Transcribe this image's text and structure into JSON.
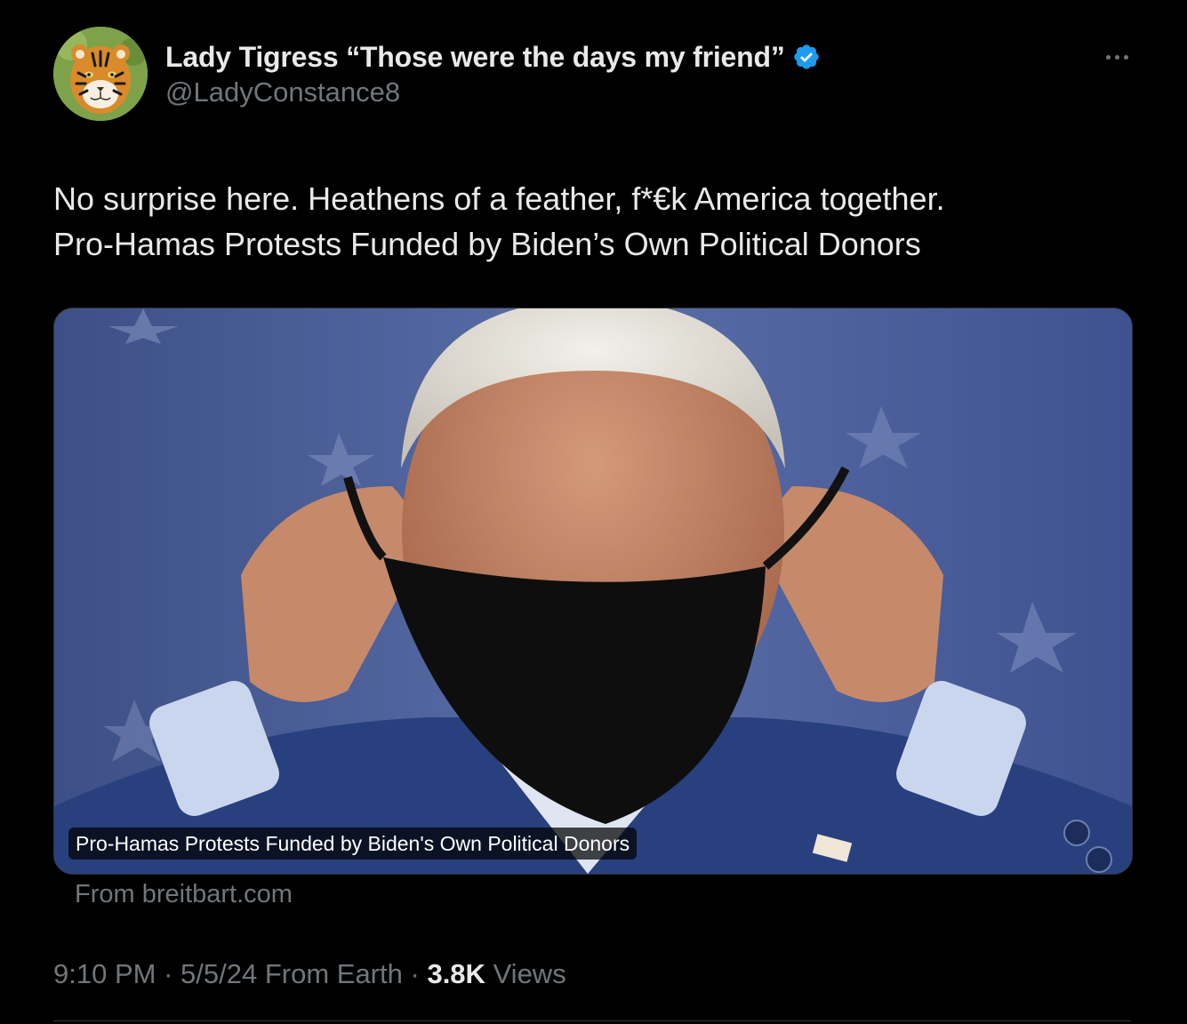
{
  "author": {
    "display_name": "Lady Tigress “Those were the days my friend”",
    "handle": "@LadyConstance8",
    "verified": true,
    "verified_color": "#1d9bf0",
    "avatar_icon": "tiger-avatar"
  },
  "tweet": {
    "text_lines": [
      "No surprise here. Heathens of a feather, f*€k America together.",
      "Pro-Hamas Protests Funded by Biden’s Own Political Donors"
    ]
  },
  "card": {
    "caption": "Pro-Hamas Protests Funded by Biden's Own Political Donors",
    "source": "From breitbart.com",
    "image_description_icon": "news-photo"
  },
  "meta": {
    "time": "9:10 PM",
    "separator": "·",
    "date_source": "5/5/24 From Earth",
    "views_count": "3.8K",
    "views_label": "Views"
  },
  "colors": {
    "background": "#000000",
    "primary_text": "#e7e9ea",
    "secondary_text": "#71767b",
    "border": "#2f3336"
  }
}
